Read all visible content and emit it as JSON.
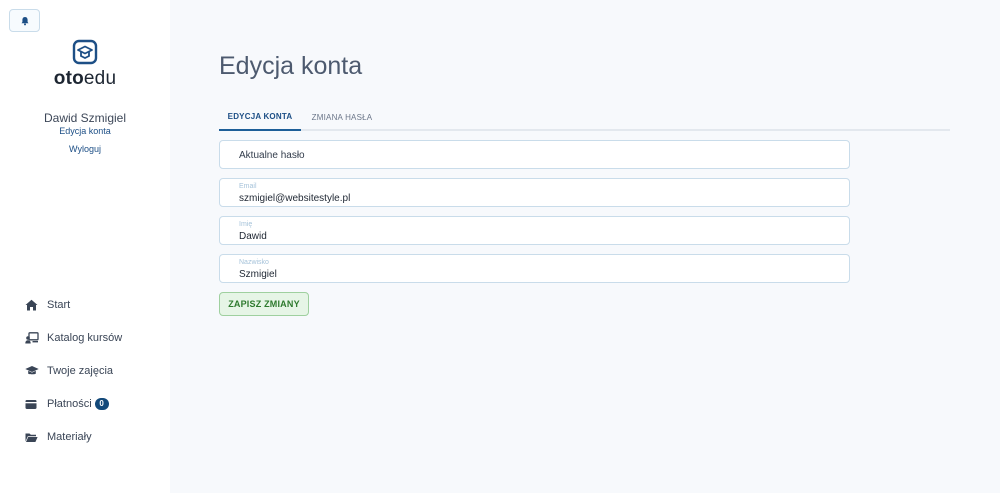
{
  "brand": {
    "name_bold": "oto",
    "name_rest": "edu"
  },
  "user": {
    "name": "Dawid Szmigiel",
    "edit_link": "Edycja konta",
    "logout_link": "Wyloguj"
  },
  "nav": {
    "items": [
      {
        "label": "Start",
        "icon": "home-icon"
      },
      {
        "label": "Katalog kursów",
        "icon": "course-catalog-icon"
      },
      {
        "label": "Twoje zajęcia",
        "icon": "graduation-cap-icon"
      },
      {
        "label": "Płatności",
        "icon": "wallet-icon",
        "badge": "0"
      },
      {
        "label": "Materiały",
        "icon": "folder-open-icon"
      }
    ]
  },
  "page": {
    "title": "Edycja konta"
  },
  "tabs": [
    {
      "label": "EDYCJA KONTA",
      "active": true
    },
    {
      "label": "ZMIANA HASŁA",
      "active": false
    }
  ],
  "form": {
    "current_password": {
      "placeholder": "Aktualne hasło",
      "value": ""
    },
    "email": {
      "label": "Email",
      "value": "szmigiel@websitestyle.pl"
    },
    "first_name": {
      "label": "Imię",
      "value": "Dawid"
    },
    "last_name": {
      "label": "Nazwisko",
      "value": "Szmigiel"
    },
    "save_label": "ZAPISZ ZMIANY"
  },
  "colors": {
    "accent": "#1d4f86",
    "badge": "#13497a",
    "save_bg": "#e6f5e6",
    "save_text": "#2e7a2e"
  }
}
